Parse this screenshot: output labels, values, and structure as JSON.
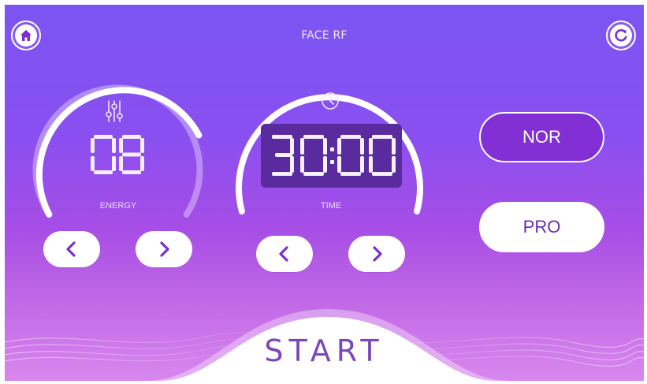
{
  "header": {
    "title": "FACE RF",
    "home_icon": "home-icon",
    "refresh_icon": "refresh-icon"
  },
  "energy": {
    "label": "ENERGY",
    "value": "08",
    "icon": "sliders-icon",
    "level": 0.8
  },
  "time": {
    "label": "TIME",
    "value": "30:00",
    "icon": "clock-icon"
  },
  "modes": {
    "nor_label": "NOR",
    "pro_label": "PRO",
    "selected": "NOR"
  },
  "start": {
    "label": "START"
  },
  "colors": {
    "accent": "#7a2fd0",
    "background_top": "#7b55f2",
    "background_bottom": "#d887ee"
  }
}
